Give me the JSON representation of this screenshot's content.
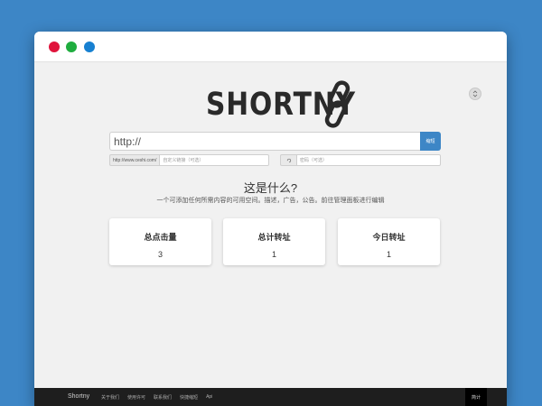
{
  "window": {
    "controls": [
      "close",
      "minimize",
      "maximize"
    ],
    "colors": {
      "close": "#e0143c",
      "minimize": "#1fad3f",
      "maximize": "#1780d1"
    }
  },
  "header": {
    "logo_text": "SHORTNY",
    "logo_icon": "chain-link-icon",
    "settings_icon": "settings-toggle-icon"
  },
  "shorten": {
    "url_placeholder": "http://",
    "button_label": "缩短",
    "domain_prefix": "http://www.ceshi.com/",
    "alias_placeholder": "自定义链接（可选）",
    "password_icon": "lock-icon",
    "password_placeholder": "密码（可选）"
  },
  "about": {
    "title": "这是什么?",
    "description": "一个可添加任何所需内容的可用空间。描述，广告，公告。前往管理面板进行编辑"
  },
  "stats": [
    {
      "label": "总点击量",
      "value": "3"
    },
    {
      "label": "总计转址",
      "value": "1"
    },
    {
      "label": "今日转址",
      "value": "1"
    }
  ],
  "footer": {
    "brand": "Shortny",
    "links": [
      "关于我们",
      "使用许可",
      "联系我们",
      "快捷缩短",
      "Api"
    ],
    "lang_button": "简计"
  },
  "colors": {
    "background": "#3d86c6",
    "accent": "#3d86c6",
    "footer": "#1e1e1e"
  }
}
